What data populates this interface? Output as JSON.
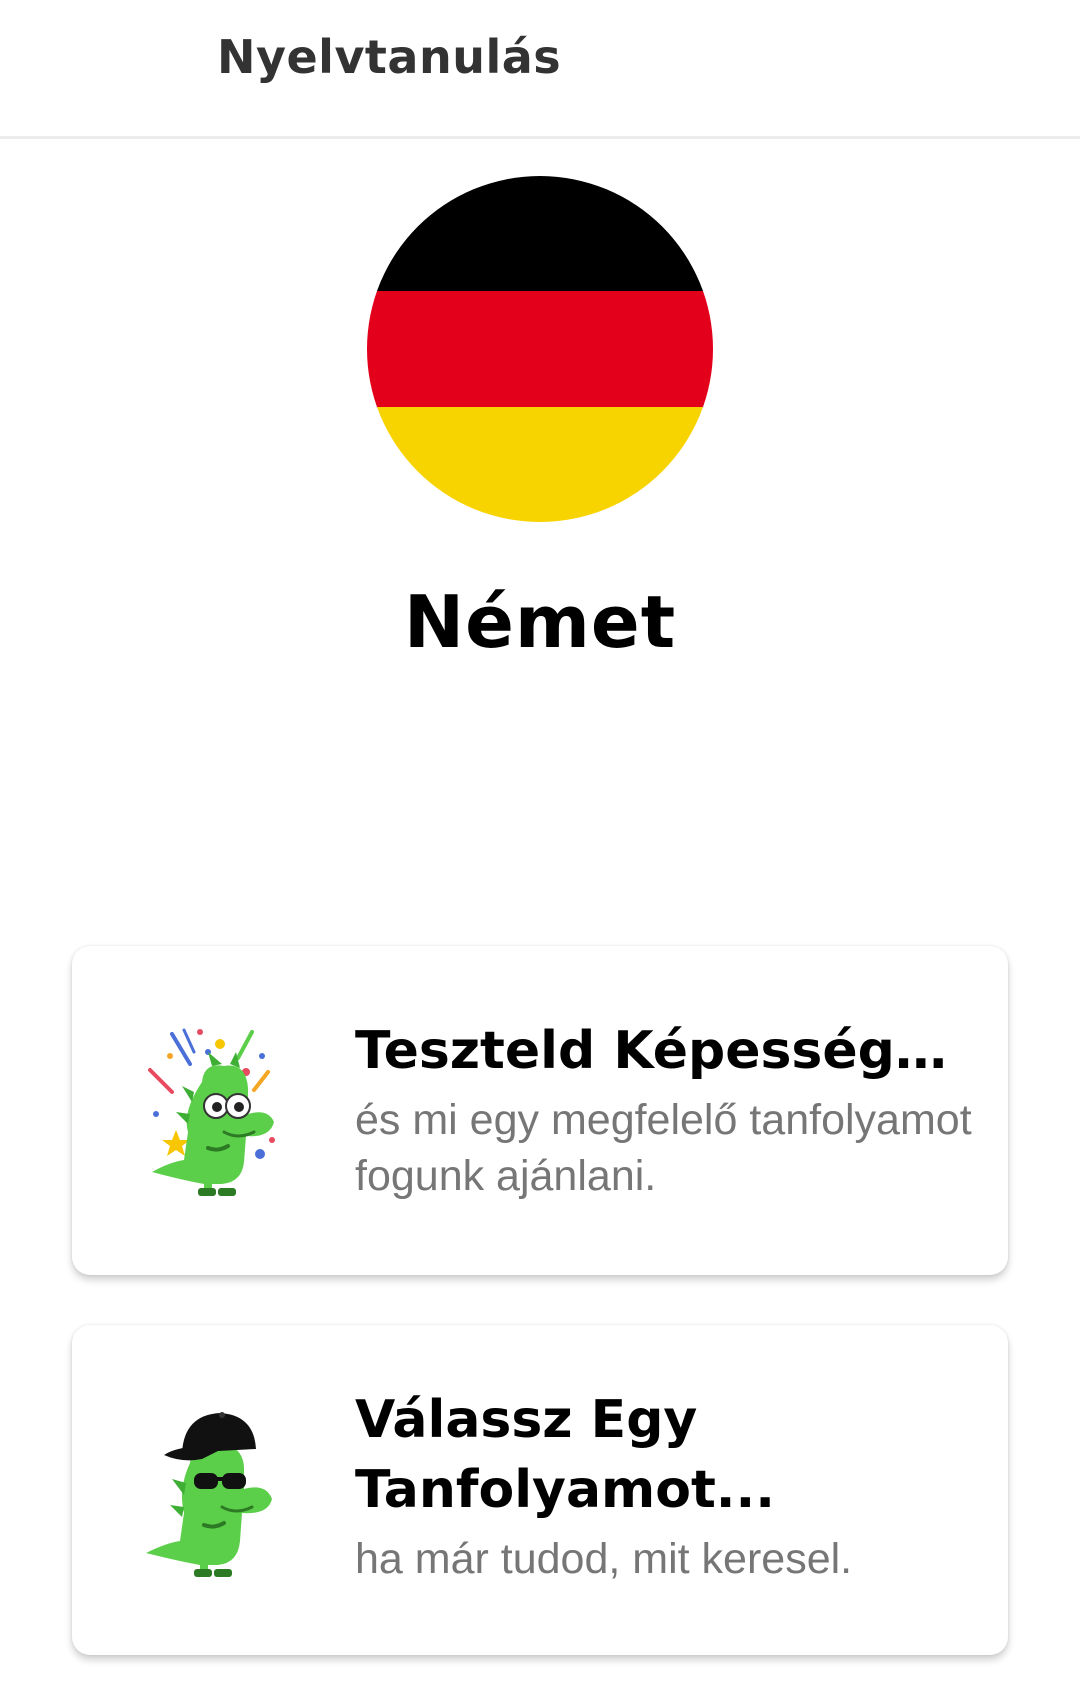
{
  "appbar": {
    "title": "Nyelvtanulás"
  },
  "language": {
    "name": "Német",
    "flag_colors": [
      "#000000",
      "#e3001b",
      "#f7d300"
    ]
  },
  "cards": [
    {
      "title": "Teszteld Képességeid...",
      "subtitle": "és mi egy megfelelő tanfolyamot fogunk ajánlani.",
      "icon": "party-dino-icon"
    },
    {
      "title": "Válassz Egy Tanfolyamot...",
      "subtitle": "ha már tudod, mit keresel.",
      "icon": "cool-dino-icon"
    }
  ],
  "colors": {
    "dino_green": "#5ccf4a",
    "subtitle_gray": "#767676"
  }
}
